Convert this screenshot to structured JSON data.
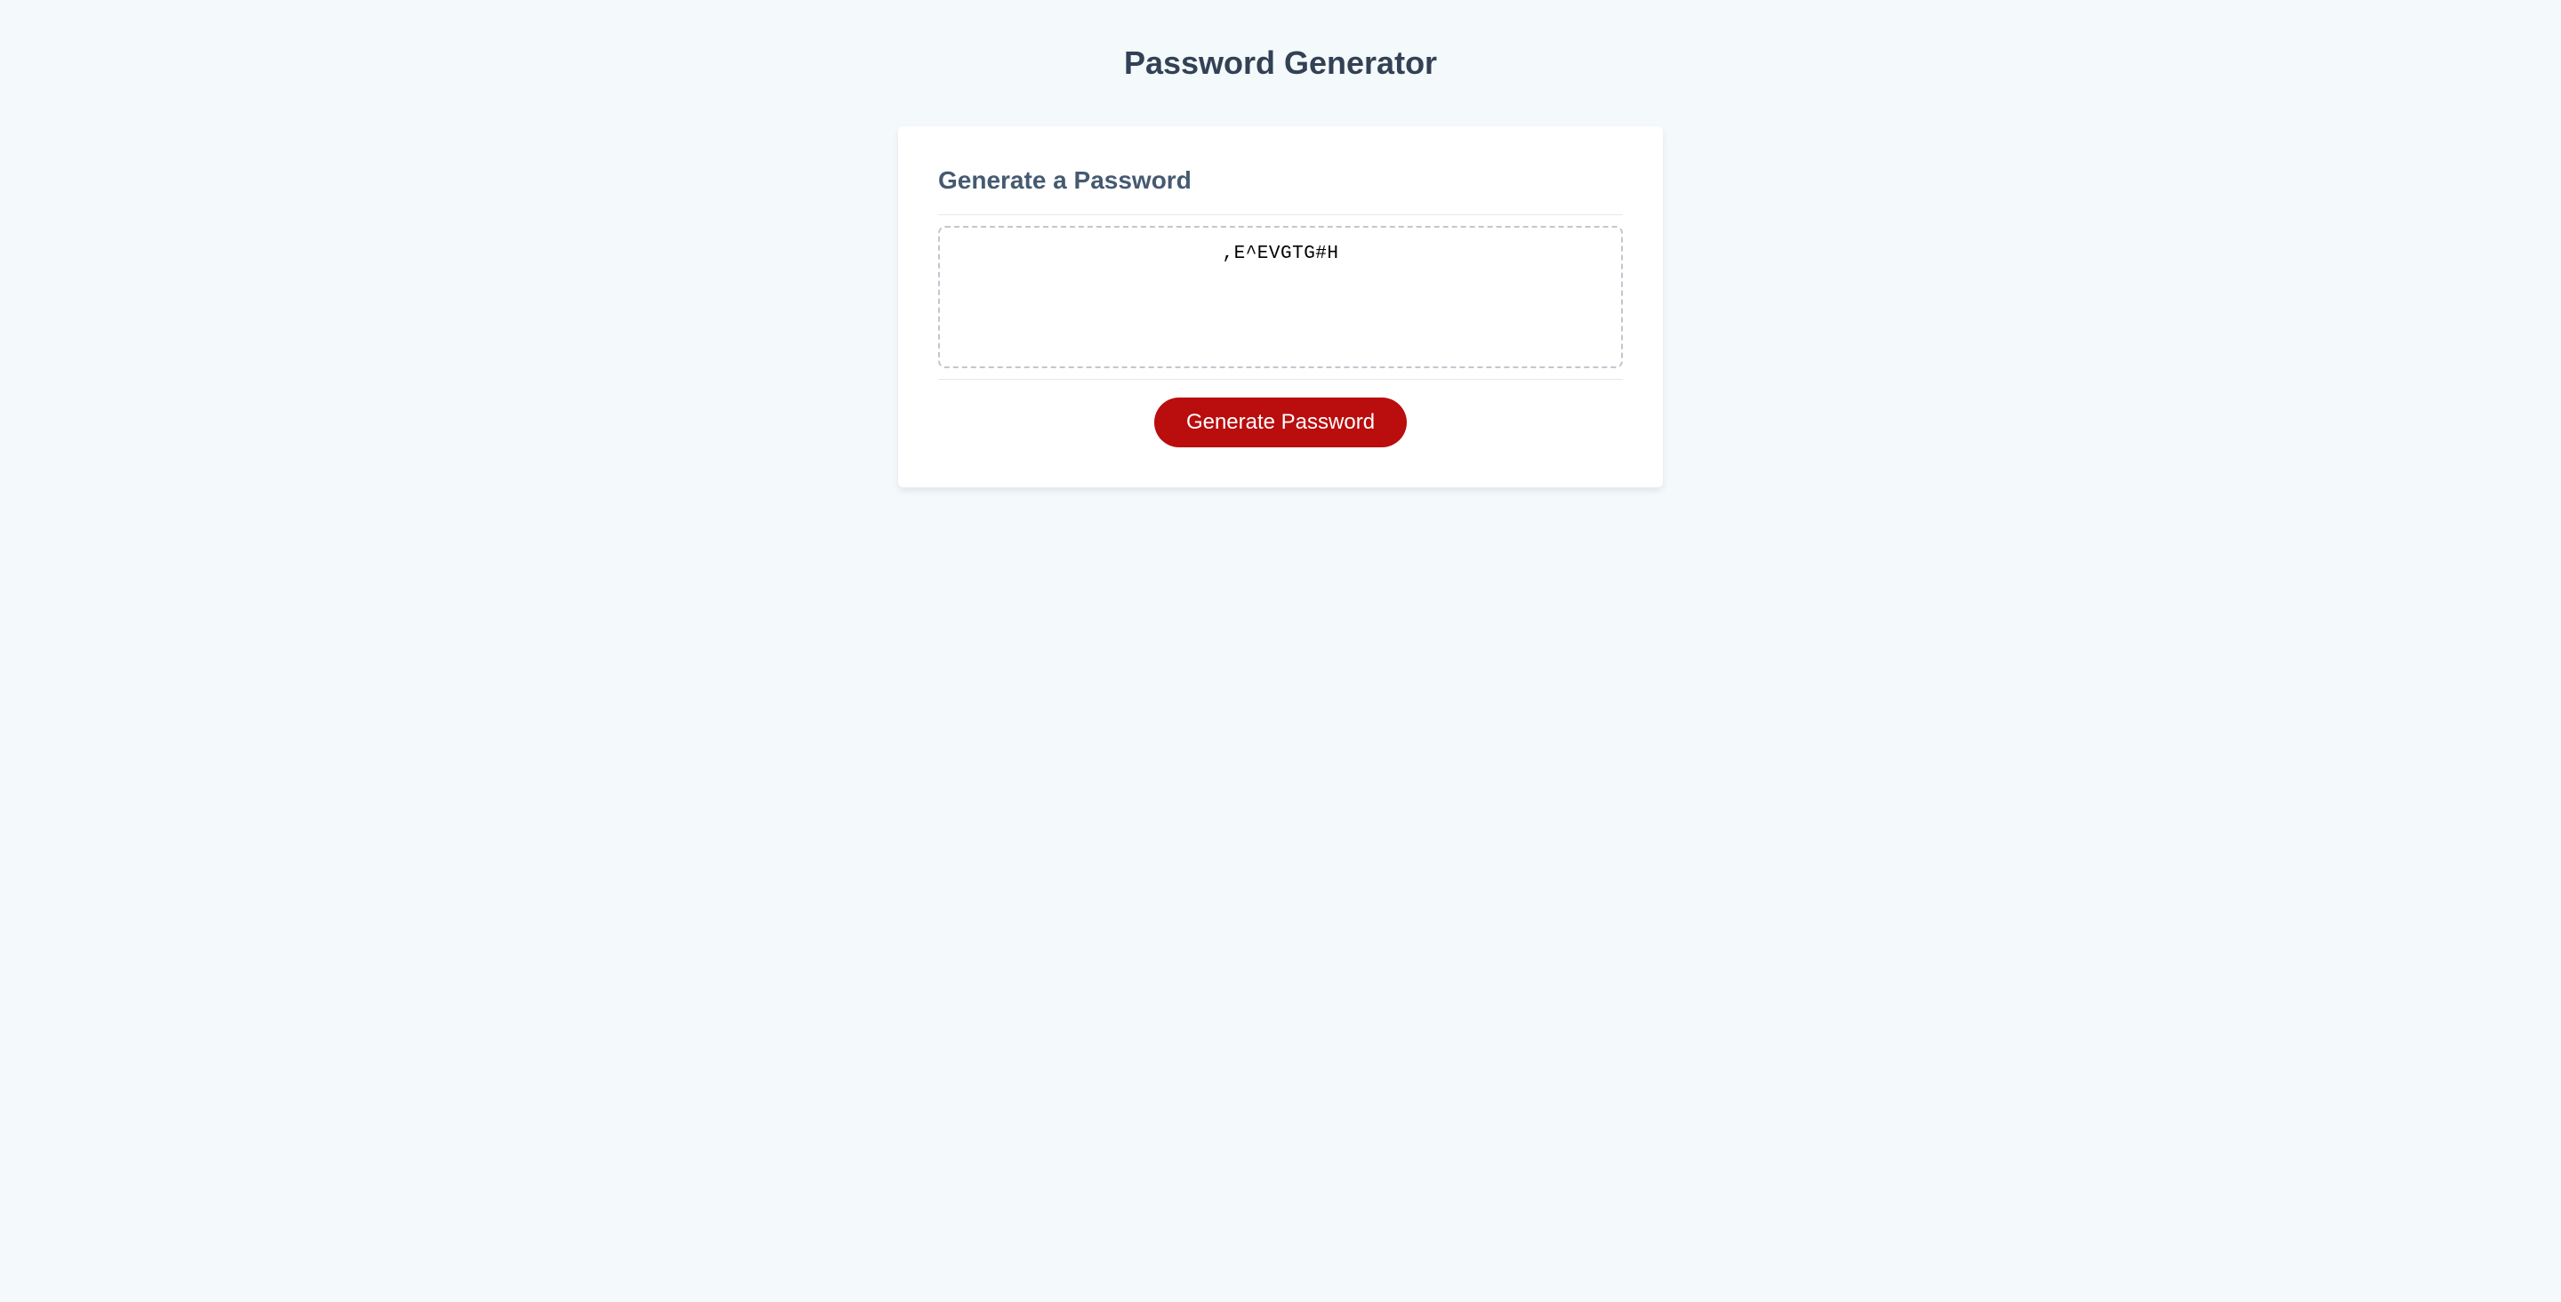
{
  "header": {
    "title": "Password Generator"
  },
  "card": {
    "title": "Generate a Password",
    "password_value": ",E^EVGTG#H",
    "generate_button_label": "Generate Password"
  }
}
